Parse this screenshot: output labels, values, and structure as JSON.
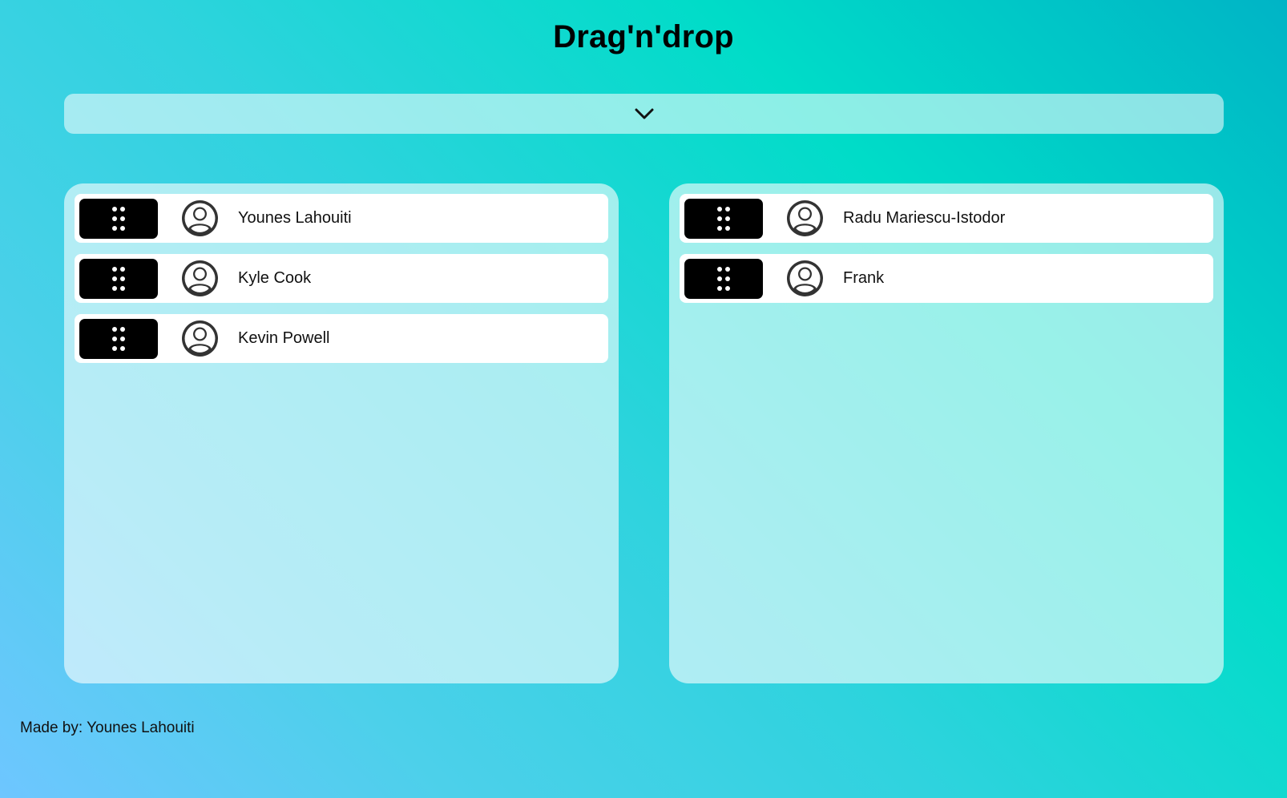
{
  "header": {
    "title": "Drag'n'drop"
  },
  "toggle": {
    "icon": "chevron-down-icon"
  },
  "columns": [
    {
      "items": [
        {
          "name": "Younes Lahouiti",
          "icon": "user-avatar-icon"
        },
        {
          "name": "Kyle Cook",
          "icon": "user-avatar-icon"
        },
        {
          "name": "Kevin Powell",
          "icon": "user-avatar-icon"
        }
      ]
    },
    {
      "items": [
        {
          "name": "Radu Mariescu-Istodor",
          "icon": "user-avatar-icon"
        },
        {
          "name": "Frank",
          "icon": "user-avatar-icon"
        }
      ]
    }
  ],
  "footer": {
    "text": "Made by: Younes Lahouiti"
  },
  "colors": {
    "handle": "#000000",
    "card": "#ffffff",
    "avatar": "#333333"
  }
}
